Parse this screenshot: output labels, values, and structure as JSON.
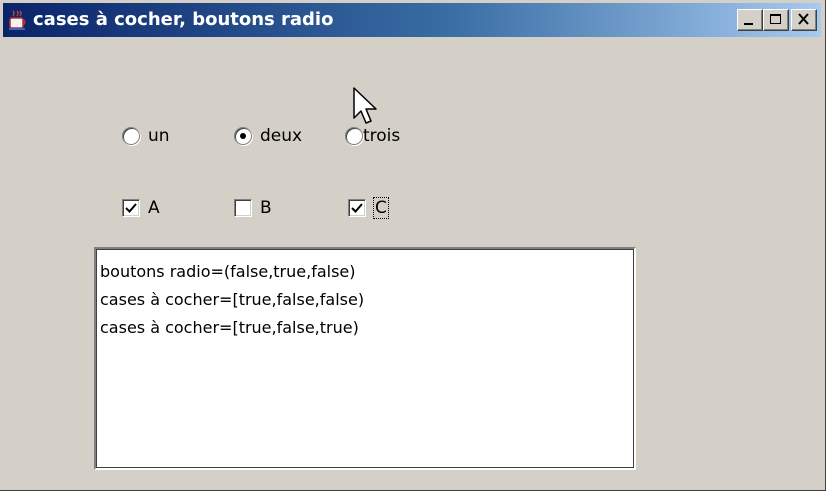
{
  "window": {
    "title": "cases à cocher, boutons radio",
    "icon": "java-coffee-icon",
    "controls": [
      "minimize-icon",
      "maximize-icon",
      "close-icon"
    ]
  },
  "radios": [
    {
      "label": "un",
      "checked": false
    },
    {
      "label": "deux",
      "checked": true
    },
    {
      "label": "trois",
      "checked": false
    }
  ],
  "checkboxes": [
    {
      "label": "A",
      "checked": true
    },
    {
      "label": "B",
      "checked": false
    },
    {
      "label": "C",
      "checked": true,
      "focused": true
    }
  ],
  "log": {
    "lines": [
      "boutons radio=(false,true,false)",
      "cases à cocher=[true,false,false)",
      "cases à cocher=[true,false,true)"
    ]
  },
  "colors": {
    "face": "#d4d0c8",
    "title_start": "#0a246a",
    "title_end": "#a6caf0"
  }
}
